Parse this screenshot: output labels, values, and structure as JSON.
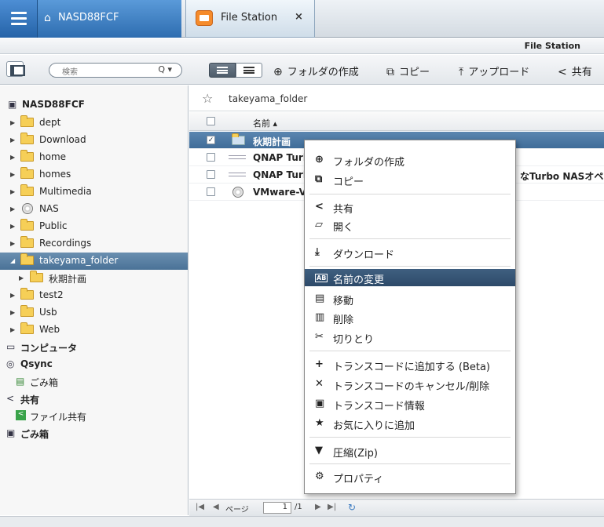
{
  "topbar": {
    "nas_name": "NASD88FCF",
    "app_tab_label": "File Station",
    "close_glyph": "×"
  },
  "window_title": "File Station",
  "toolbar": {
    "search_placeholder": "検索",
    "search_icon_glyph": "Q ▾",
    "create_folder": "フォルダの作成",
    "copy": "コピー",
    "upload": "アップロード",
    "share": "共有"
  },
  "tree": {
    "root": "NASD88FCF",
    "folders": [
      "dept",
      "Download",
      "home",
      "homes",
      "Multimedia",
      "NAS",
      "Public",
      "Recordings",
      "takeyama_folder",
      "秋期計画",
      "test2",
      "Usb",
      "Web"
    ],
    "computer": "コンピュータ",
    "qsync": "Qsync",
    "qsync_trash": "ごみ箱",
    "share": "共有",
    "file_share": "ファイル共有",
    "trash": "ごみ箱"
  },
  "main": {
    "path": "takeyama_folder",
    "name_header": "名前 ▴",
    "files": [
      {
        "name": "秋期計画",
        "checked": true
      },
      {
        "name": "QNAP Turb"
      },
      {
        "name": "QNAP Turb",
        "extra": "なTurbo NASオペレー"
      },
      {
        "name": "VMware-VN"
      }
    ]
  },
  "pager": {
    "page_label": "ページ",
    "page_value": "1",
    "page_total": "/1"
  },
  "context_menu": {
    "items": [
      {
        "label": "フォルダの作成",
        "icon": "plus-circle-icon"
      },
      {
        "label": "コピー",
        "icon": "copy-icon"
      },
      {
        "label": "共有",
        "icon": "share-icon"
      },
      {
        "label": "開く",
        "icon": "open-folder-icon"
      },
      {
        "label": "ダウンロード",
        "icon": "download-icon"
      },
      {
        "label": "名前の変更",
        "icon": "rename-icon",
        "highlighted": true
      },
      {
        "label": "移動",
        "icon": "move-icon"
      },
      {
        "label": "削除",
        "icon": "trash-icon"
      },
      {
        "label": "切りとり",
        "icon": "cut-icon"
      },
      {
        "label": "トランスコードに追加する (Beta)",
        "icon": "plus-icon"
      },
      {
        "label": "トランスコードのキャンセル/削除",
        "icon": "x-icon"
      },
      {
        "label": "トランスコード情報",
        "icon": "info-icon"
      },
      {
        "label": "お気に入りに追加",
        "icon": "star-icon"
      },
      {
        "label": "圧縮(Zip)",
        "icon": "zip-icon"
      },
      {
        "label": "プロパティ",
        "icon": "properties-icon"
      }
    ]
  },
  "colors": {
    "accent": "#2e6db0",
    "selection": "#4a7297",
    "menu_highlight": "#2d4a69"
  }
}
